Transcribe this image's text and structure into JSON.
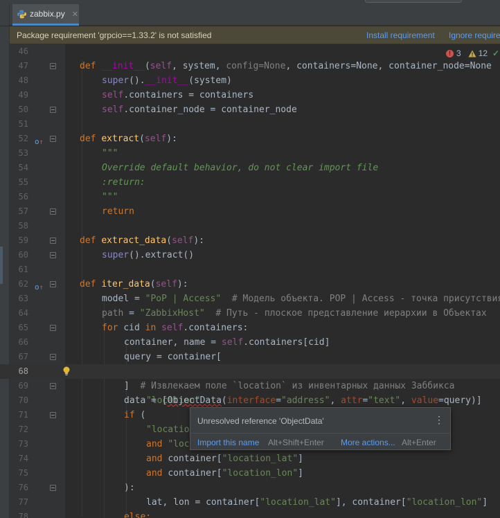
{
  "tab": {
    "filename": "zabbix.py",
    "close": "✕"
  },
  "banner": {
    "message": "Package requirement 'grpcio==1.33.2' is not satisfied",
    "install": "Install requirement",
    "ignore": "Ignore requirement"
  },
  "inspection": {
    "errors": "3",
    "warnings": "12"
  },
  "popup": {
    "title": "Unresolved reference 'ObjectData'",
    "import_label": "Import this name",
    "import_shortcut": "Alt+Shift+Enter",
    "more_label": "More actions...",
    "more_shortcut": "Alt+Enter"
  },
  "line_numbers": [
    "46",
    "47",
    "48",
    "49",
    "50",
    "51",
    "52",
    "53",
    "54",
    "55",
    "56",
    "57",
    "58",
    "59",
    "60",
    "61",
    "62",
    "63",
    "64",
    "65",
    "66",
    "67",
    "68",
    "69",
    "70",
    "71",
    "72",
    "73",
    "74",
    "75",
    "76",
    "77",
    "78"
  ],
  "code": {
    "l47_params": "system",
    "l47_config": "config=None",
    "l47_containers": "containers=None",
    "l47_node": "container_node=None",
    "l48_arg": "(system)",
    "l49": " = containers",
    "l50": " = container_node",
    "l53": "\"\"\"",
    "l54": "Override default behavior, do not clear import file",
    "l55": ":return:",
    "l56": "\"\"\"",
    "l60": "().extract()",
    "l63_str": "\"PoP | Access\"",
    "l63_cm": "# Модель объекта. POP | Access - точка присутствия",
    "l64_str": "\"ZabbixHost\"",
    "l64_cm": "# Путь - плоское представление иерархии в Объектах",
    "l66": "container, name = ",
    "l66b": ".containers[cid]",
    "l67": "query = container[",
    "l68": "\"location\"",
    "l69_cm": "# Извлекаем поле `location` из инвентарных данных Заббикса",
    "l70_a": "data = [",
    "l70_od": "ObjectData",
    "l70_iface": "\"address\"",
    "l70_attr": "\"text\"",
    "l70_end": "=query)]",
    "l72_str": "\"location",
    "l73_str": "\"loc",
    "l74_str": "\"location_lat\"",
    "l75_str": "\"location_lon\"",
    "l77_a": "lat, lon = container[",
    "l77_s1": "\"location_lat\"",
    "l77_b": "], container[",
    "l77_s2": "\"location_lon\"",
    "l77_c": "]",
    "l78": "else:"
  }
}
